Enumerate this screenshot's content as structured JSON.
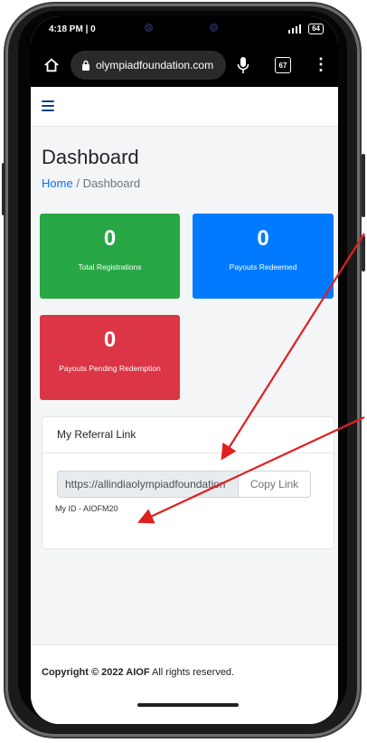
{
  "status_bar": {
    "time": "4:18 PM | 0",
    "signal": "4G",
    "battery": "64"
  },
  "browser": {
    "url": "olympiadfoundation.com",
    "tab_count": "67"
  },
  "page": {
    "title": "Dashboard",
    "breadcrumb": {
      "home": "Home",
      "separator": "/",
      "current": "Dashboard"
    }
  },
  "stats": [
    {
      "value": "0",
      "label": "Total Registrations",
      "color": "#28a745"
    },
    {
      "value": "0",
      "label": "Payouts Redeemed",
      "color": "#007bff"
    },
    {
      "value": "0",
      "label": "Payouts Pending Redemption",
      "color": "#dc3545"
    }
  ],
  "referral": {
    "title": "My Referral Link",
    "link_value": "https://allindiaolympiadfoundation",
    "copy_label": "Copy Link",
    "my_id": "My ID - AIOFM20"
  },
  "footer": {
    "copyright_bold": "Copyright © 2022 AIOF",
    "rest": "All rights reserved."
  },
  "colors": {
    "annotation_arrow": "#e02020",
    "nav_accent": "#0d3c8c",
    "link": "#0d6efd"
  }
}
